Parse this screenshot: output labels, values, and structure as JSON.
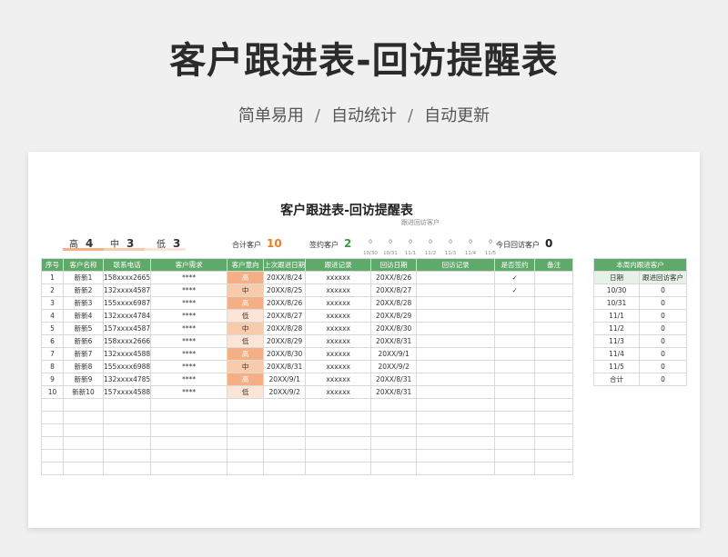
{
  "hero": {
    "title": "客户跟进表-回访提醒表",
    "subtitle_parts": [
      "简单易用",
      "自动统计",
      "自动更新"
    ],
    "separator": "/"
  },
  "sheet": {
    "title": "客户跟进表-回访提醒表",
    "caption_followup": "跟进回访客户",
    "priority": {
      "high_label": "高",
      "high_count": "4",
      "mid_label": "中",
      "mid_count": "3",
      "low_label": "低",
      "low_count": "3"
    },
    "total_label": "合计客户",
    "total_value": "10",
    "signed_label": "签约客户",
    "signed_value": "2",
    "today_label": "今日回访客户",
    "today_value": "0",
    "day_counts": [
      "0",
      "0",
      "0",
      "0",
      "0",
      "0",
      "0"
    ],
    "day_labels": [
      "10/30",
      "10/31",
      "11/1",
      "11/2",
      "11/3",
      "11/4",
      "11/5"
    ],
    "colors": {
      "header_green": "#5faa6b",
      "high": "#f4b084",
      "mid": "#f8cbad",
      "low": "#fce4d6",
      "orange": "#e67e22"
    }
  },
  "main_table": {
    "headers": [
      "序号",
      "客户名称",
      "联系电话",
      "客户需求",
      "客户意向",
      "上次跟进日期",
      "跟进记录",
      "回访日期",
      "回访记录",
      "是否签约",
      "备注"
    ],
    "rows": [
      [
        "1",
        "新新1",
        "158xxxx2665",
        "****",
        "高",
        "20XX/8/24",
        "xxxxxx",
        "20XX/8/26",
        "",
        "✓",
        ""
      ],
      [
        "2",
        "新新2",
        "132xxxx4587",
        "****",
        "中",
        "20XX/8/25",
        "xxxxxx",
        "20XX/8/27",
        "",
        "✓",
        ""
      ],
      [
        "3",
        "新新3",
        "155xxxx6987",
        "****",
        "高",
        "20XX/8/26",
        "xxxxxx",
        "20XX/8/28",
        "",
        "",
        ""
      ],
      [
        "4",
        "新新4",
        "132xxxx4784",
        "****",
        "低",
        "20XX/8/27",
        "xxxxxx",
        "20XX/8/29",
        "",
        "",
        ""
      ],
      [
        "5",
        "新新5",
        "157xxxx4587",
        "****",
        "中",
        "20XX/8/28",
        "xxxxxx",
        "20XX/8/30",
        "",
        "",
        ""
      ],
      [
        "6",
        "新新6",
        "158xxxx2666",
        "****",
        "低",
        "20XX/8/29",
        "xxxxxx",
        "20XX/8/31",
        "",
        "",
        ""
      ],
      [
        "7",
        "新新7",
        "132xxxx4588",
        "****",
        "高",
        "20XX/8/30",
        "xxxxxx",
        "20XX/9/1",
        "",
        "",
        ""
      ],
      [
        "8",
        "新新8",
        "155xxxx6988",
        "****",
        "中",
        "20XX/8/31",
        "xxxxxx",
        "20XX/9/2",
        "",
        "",
        ""
      ],
      [
        "9",
        "新新9",
        "132xxxx4785",
        "****",
        "高",
        "20XX/9/1",
        "xxxxxx",
        "20XX/8/31",
        "",
        "",
        ""
      ],
      [
        "10",
        "新新10",
        "157xxxx4588",
        "****",
        "低",
        "20XX/9/2",
        "xxxxxx",
        "20XX/8/31",
        "",
        "",
        ""
      ]
    ],
    "empty_rows": 6
  },
  "side_table": {
    "title": "本周内跟进客户",
    "headers": [
      "日期",
      "跟进回访客户"
    ],
    "rows": [
      [
        "10/30",
        "0"
      ],
      [
        "10/31",
        "0"
      ],
      [
        "11/1",
        "0"
      ],
      [
        "11/2",
        "0"
      ],
      [
        "11/3",
        "0"
      ],
      [
        "11/4",
        "0"
      ],
      [
        "11/5",
        "0"
      ],
      [
        "合计",
        "0"
      ]
    ]
  }
}
